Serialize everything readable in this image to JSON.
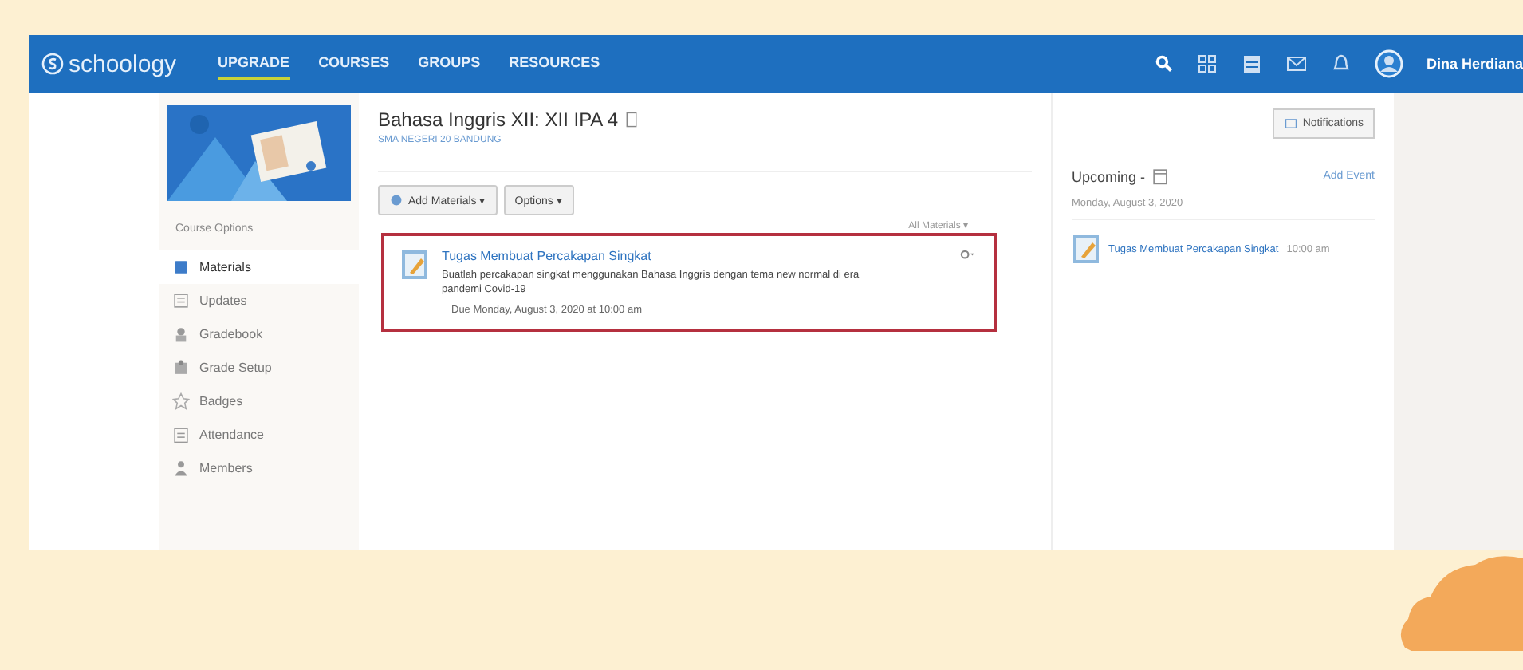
{
  "nav": {
    "logo": "schoology",
    "links": [
      {
        "label": "UPGRADE",
        "selected": true
      },
      {
        "label": "COURSES",
        "selected": false
      },
      {
        "label": "GROUPS",
        "selected": false
      },
      {
        "label": "RESOURCES",
        "selected": false
      }
    ],
    "user": "Dina Herdiana"
  },
  "sidebar": {
    "course_options": "Course Options",
    "items": [
      {
        "label": "Materials",
        "selected": true
      },
      {
        "label": "Updates",
        "selected": false
      },
      {
        "label": "Gradebook",
        "selected": false
      },
      {
        "label": "Grade Setup",
        "selected": false
      },
      {
        "label": "Badges",
        "selected": false
      },
      {
        "label": "Attendance",
        "selected": false
      },
      {
        "label": "Members",
        "selected": false
      }
    ]
  },
  "course": {
    "title": "Bahasa Inggris XII: XII IPA 4",
    "school": "SMA NEGERI 20 BANDUNG",
    "buttons": [
      "Add Materials ▾",
      "Options ▾"
    ],
    "filter": "All Materials ▾"
  },
  "materials": [
    {
      "title": "Tugas Membuat Percakapan Singkat",
      "description": "Buatlah percakapan singkat menggunakan Bahasa Inggris dengan tema new normal di era pandemi Covid-19",
      "due": "Due Monday, August 3, 2020 at 10:00 am",
      "highlighted": true
    }
  ],
  "notifications_button": "Notifications",
  "upcoming": {
    "title": "Upcoming -",
    "add_event": "Add Event",
    "date": "Monday, August 3, 2020",
    "events": [
      {
        "title": "Tugas Membuat Percakapan Singkat",
        "time": "10:00 am"
      }
    ]
  }
}
